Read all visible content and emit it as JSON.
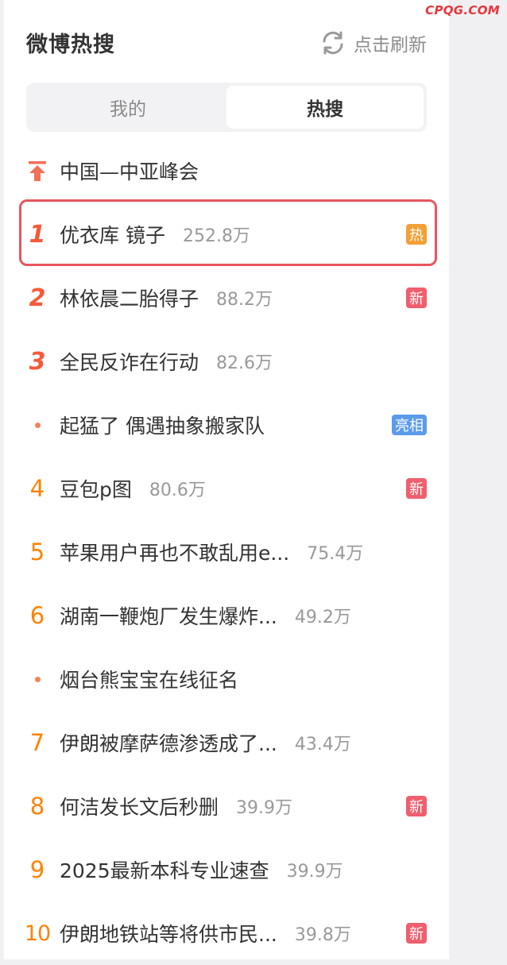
{
  "watermark": "CPQG.COM",
  "header": {
    "title": "微博热搜",
    "refresh_label": "点击刷新",
    "refresh_icon": "refresh-icon"
  },
  "tabs": [
    {
      "label": "我的",
      "active": false
    },
    {
      "label": "热搜",
      "active": true
    }
  ],
  "pinned": {
    "icon": "pin-top-icon",
    "text": "中国—中亚峰会"
  },
  "items": [
    {
      "rank": "1",
      "text": "优衣库 镜子",
      "hot": "252.8万",
      "badge": "热"
    },
    {
      "rank": "2",
      "text": "林依晨二胎得子",
      "hot": "88.2万",
      "badge": "新"
    },
    {
      "rank": "3",
      "text": "全民反诈在行动",
      "hot": "82.6万",
      "badge": ""
    },
    {
      "rank": "",
      "text": "起猛了 偶遇抽象搬家队",
      "hot": "",
      "badge": "亮相"
    },
    {
      "rank": "4",
      "text": "豆包p图",
      "hot": "80.6万",
      "badge": "新"
    },
    {
      "rank": "5",
      "text": "苹果用户再也不敢乱用e...",
      "hot": "75.4万",
      "badge": ""
    },
    {
      "rank": "6",
      "text": "湖南一鞭炮厂发生爆炸...",
      "hot": "49.2万",
      "badge": ""
    },
    {
      "rank": "",
      "text": "烟台熊宝宝在线征名",
      "hot": "",
      "badge": ""
    },
    {
      "rank": "7",
      "text": "伊朗被摩萨德渗透成了...",
      "hot": "43.4万",
      "badge": ""
    },
    {
      "rank": "8",
      "text": "何洁发长文后秒删",
      "hot": "39.9万",
      "badge": "新"
    },
    {
      "rank": "9",
      "text": "2025最新本科专业速查",
      "hot": "39.9万",
      "badge": ""
    },
    {
      "rank": "10",
      "text": "伊朗地铁站等将供市民...",
      "hot": "39.8万",
      "badge": "新"
    }
  ],
  "colors": {
    "accent": "#ff8200",
    "top_rank": "#f55a3a",
    "highlight_border": "#e8555f",
    "badge_hot": "#f3a036",
    "badge_new": "#ef5f6e",
    "badge_liang": "#5b9bea"
  }
}
